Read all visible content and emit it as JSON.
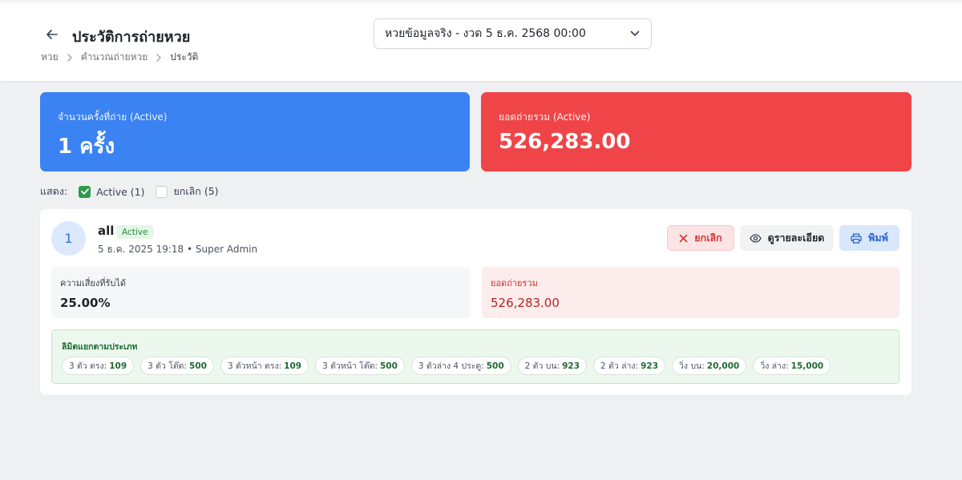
{
  "header": {
    "title": "ประวัติการถ่ายหวย",
    "breadcrumb": [
      "หวย",
      "คำนวณถ่ายหวย",
      "ประวัติ"
    ],
    "round_select_value": "หวยข้อมูลจริง - งวด 5 ธ.ค. 2568 00:00"
  },
  "stats": {
    "count_label": "จำนวนครั้งที่ถ่าย (Active)",
    "count_value": "1 ครั้ง",
    "total_label": "ยอดถ่ายรวม (Active)",
    "total_value": "526,283.00"
  },
  "filters": {
    "label": "แสดง:",
    "active_label": "Active (1)",
    "active_checked": true,
    "cancelled_label": "ยกเลิก (5)",
    "cancelled_checked": false
  },
  "entry": {
    "number": "1",
    "name": "all",
    "status": "Active",
    "meta": "5 ธ.ค. 2025 19:18 • Super Admin",
    "actions": {
      "cancel": "ยกเลิก",
      "details": "ดูรายละเอียด",
      "print": "พิมพ์"
    },
    "risk_label": "ความเสี่ยงที่รับได้",
    "risk_value": "25.00%",
    "total_label": "ยอดถ่ายรวม",
    "total_value": "526,283.00",
    "limits_title": "ลิมิตแยกตามประเภท",
    "limits": [
      {
        "label": "3 ตัว ตรง:",
        "value": "109"
      },
      {
        "label": "3 ตัว โต๊ด:",
        "value": "500"
      },
      {
        "label": "3 ตัวหน้า ตรง:",
        "value": "109"
      },
      {
        "label": "3 ตัวหน้า โต๊ด:",
        "value": "500"
      },
      {
        "label": "3 ตัวล่าง 4 ประตู:",
        "value": "500"
      },
      {
        "label": "2 ตัว บน:",
        "value": "923"
      },
      {
        "label": "2 ตัว ล่าง:",
        "value": "923"
      },
      {
        "label": "วิ่ง บน:",
        "value": "20,000"
      },
      {
        "label": "วิ่ง ล่าง:",
        "value": "15,000"
      }
    ]
  },
  "colors": {
    "blue_card": "#3b82f2",
    "red_card": "#ef4548",
    "active_green": "#2e9a4b"
  },
  "icons": [
    "arrow-left-icon",
    "chevron-right-icon",
    "chevron-down-icon",
    "check-icon",
    "close-icon",
    "eye-icon",
    "printer-icon"
  ]
}
